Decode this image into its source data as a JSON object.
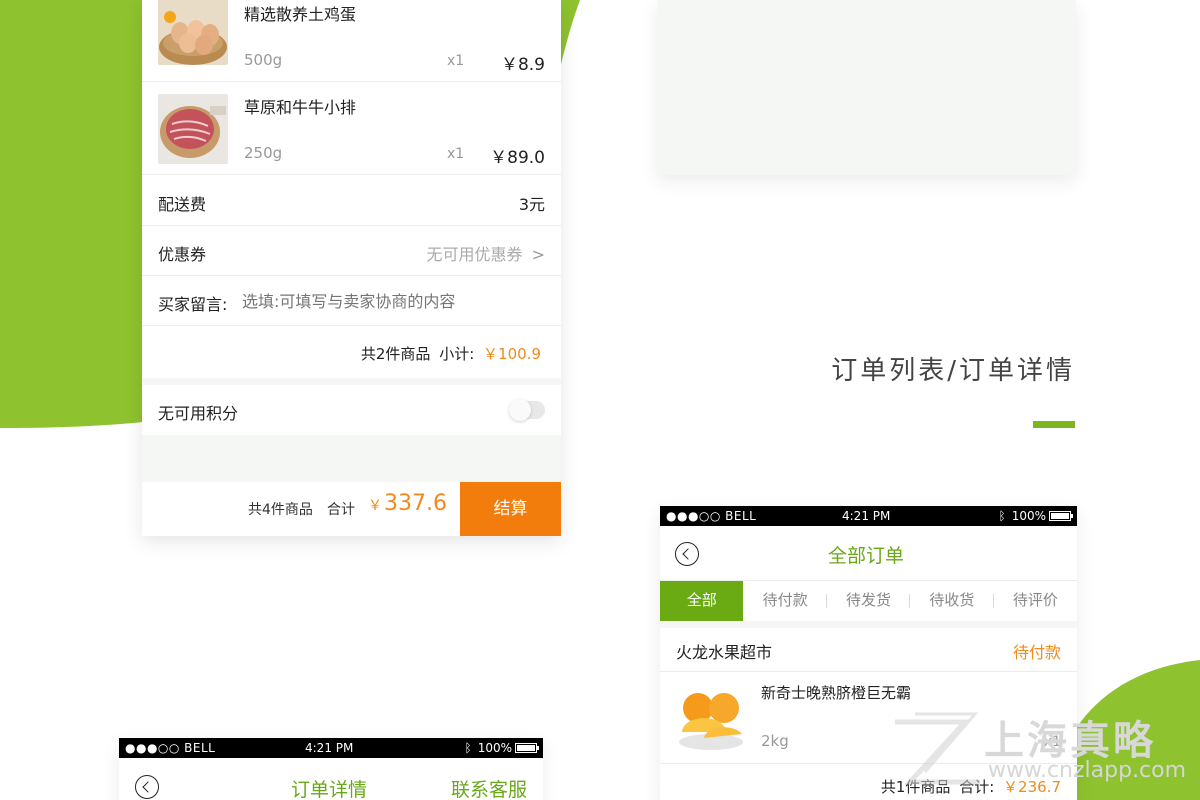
{
  "colors": {
    "brand_green": "#7cb51d",
    "accent_orange": "#f28a1c",
    "pay_button": "#f27d0c"
  },
  "checkout": {
    "products": [
      {
        "name": "精选散养土鸡蛋",
        "spec": "500g",
        "qty": "x1",
        "price": "￥8.9",
        "image": "eggs-basket"
      },
      {
        "name": "草原和牛牛小排",
        "spec": "250g",
        "qty": "x1",
        "price": "￥89.0",
        "image": "beef-plate"
      }
    ],
    "delivery": {
      "label": "配送费",
      "value": "3元"
    },
    "coupon": {
      "label": "优惠券",
      "value": "无可用优惠券"
    },
    "message": {
      "label": "买家留言:",
      "placeholder": "选填:可填写与卖家协商的内容"
    },
    "subtotal": {
      "count_text": "共2件商品",
      "label": "小计:",
      "value": "￥100.9"
    },
    "points": {
      "label": "无可用积分",
      "enabled": false
    },
    "footer": {
      "count_text": "共4件商品",
      "total_label": "合计",
      "currency": "￥",
      "total": "337.6",
      "pay_label": "结算"
    }
  },
  "section": {
    "title": "订单列表/订单详情"
  },
  "status_bar": {
    "signal": "●●●○○ BELL",
    "time": "4:21 PM",
    "battery": "100%"
  },
  "order_detail": {
    "title": "订单详情",
    "service": "联系客服"
  },
  "orders": {
    "title": "全部订单",
    "tabs": [
      "全部",
      "待付款",
      "待发货",
      "待收货",
      "待评价"
    ],
    "shop": "火龙水果超市",
    "state": "待付款",
    "item": {
      "name": "新奇士晚熟脐橙巨无霸",
      "spec": "2kg",
      "qty": "x1",
      "image": "oranges"
    },
    "summary": {
      "count_text": "共1件商品",
      "label": "合计:",
      "value": "￥236.7"
    }
  },
  "watermark": {
    "name": "上海真略",
    "url": "www.cnzlapp.com"
  }
}
